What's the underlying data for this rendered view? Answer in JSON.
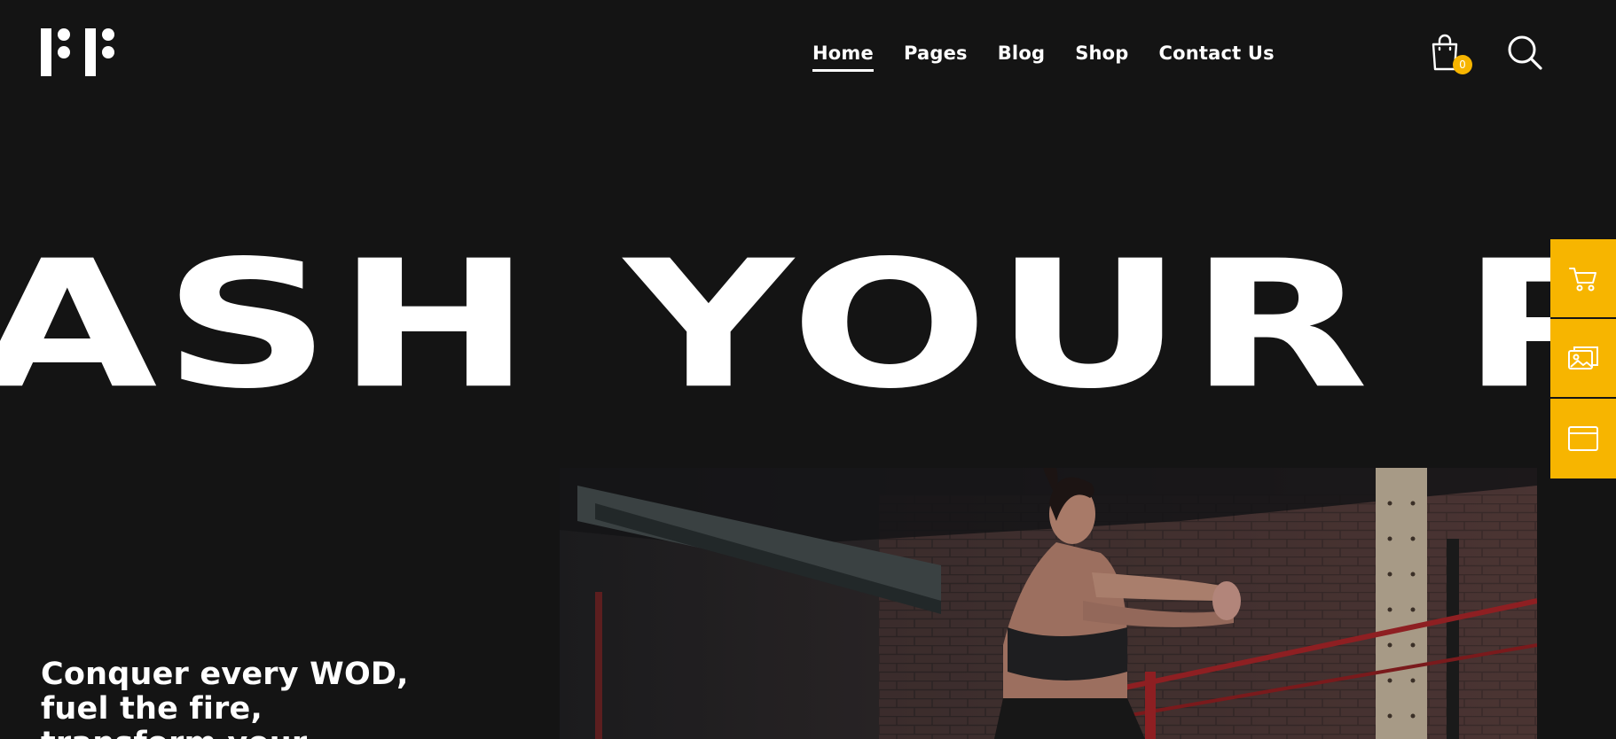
{
  "header": {
    "logo_alt": "PF",
    "nav": [
      {
        "label": "Home",
        "active": true
      },
      {
        "label": "Pages",
        "active": false
      },
      {
        "label": "Blog",
        "active": false
      },
      {
        "label": "Shop",
        "active": false
      },
      {
        "label": "Contact Us",
        "active": false
      }
    ],
    "cart_count": "0",
    "icons": {
      "cart": "shopping-bag-icon",
      "search": "search-icon"
    }
  },
  "hero": {
    "headline": "ASH YOUR P",
    "tagline": "Conquer every WOD, fuel the fire, transform your"
  },
  "side_dock": {
    "items": [
      {
        "icon": "cart-icon"
      },
      {
        "icon": "gallery-icon"
      },
      {
        "icon": "browser-window-icon"
      }
    ]
  },
  "colors": {
    "background": "#141414",
    "accent": "#f7b500",
    "text": "#ffffff"
  }
}
